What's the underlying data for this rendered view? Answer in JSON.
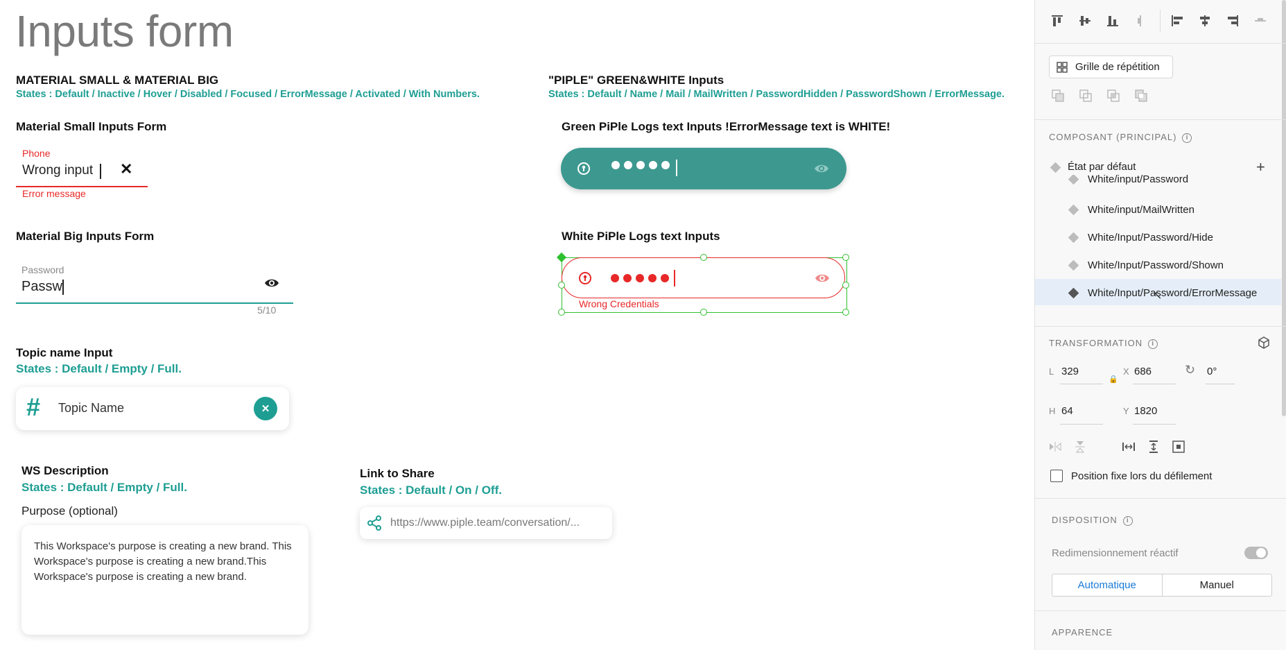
{
  "page": {
    "title": "Inputs form"
  },
  "material": {
    "heading": "MATERIAL SMALL & MATERIAL BIG",
    "states": "States : Default / Inactive / Hover / Disabled / Focused  / ErrorMessage / Activated / With Numbers.",
    "small_title": "Material Small Inputs Form",
    "small_label": "Phone",
    "small_value": "Wrong input",
    "small_error": "Error message",
    "big_title": "Material Big Inputs Form",
    "big_label": "Password",
    "big_value": "Passw",
    "big_counter": "5/10"
  },
  "piple": {
    "heading": "\"PIPLE\" GREEN&WHITE Inputs",
    "states": "States : Default / Name / Mail / MailWritten / PasswordHidden / PasswordShown  / ErrorMessage.",
    "green_title": "Green PiPle Logs text Inputs !ErrorMessage text is WHITE!",
    "white_title": "White PiPle Logs text Inputs",
    "white_error": "Wrong Credentials"
  },
  "topic": {
    "title": "Topic name Input",
    "states": "States : Default / Empty / Full.",
    "value": "Topic Name"
  },
  "ws": {
    "title": "WS Description",
    "states": "States : Default / Empty / Full.",
    "label": "Purpose (optional)",
    "value": "This Workspace's purpose is creating a new brand. This Workspace's purpose is creating a new brand.This Workspace's purpose is creating a new brand."
  },
  "link": {
    "title": "Link to Share",
    "states": "States : Default / On / Off.",
    "value": "https://www.piple.team/conversation/..."
  },
  "panel": {
    "repeat_grid": "Grille de répétition",
    "component_heading": "COMPOSANT (PRINCIPAL)",
    "default_state": "État par défaut",
    "states": [
      "White/input/Password",
      "White/input/MailWritten",
      "White/Input/Password/Hide",
      "White/Input/Password/Shown",
      "White/Input/Password/ErrorMessage"
    ],
    "transform_heading": "TRANSFORMATION",
    "w_label": "L",
    "w_value": "329",
    "x_label": "X",
    "x_value": "686",
    "rotation_value": "0°",
    "h_label": "H",
    "h_value": "64",
    "y_label": "Y",
    "y_value": "1820",
    "fixed_position": "Position fixe lors du défilement",
    "disposition_heading": "DISPOSITION",
    "responsive_resize": "Redimensionnement réactif",
    "auto_label": "Automatique",
    "manual_label": "Manuel",
    "appearance_heading": "APPARENCE"
  },
  "colors": {
    "teal": "#1e9e93",
    "red": "#e82828",
    "selection_green": "#2fc02f",
    "panel_selected": "#e5eef8"
  }
}
